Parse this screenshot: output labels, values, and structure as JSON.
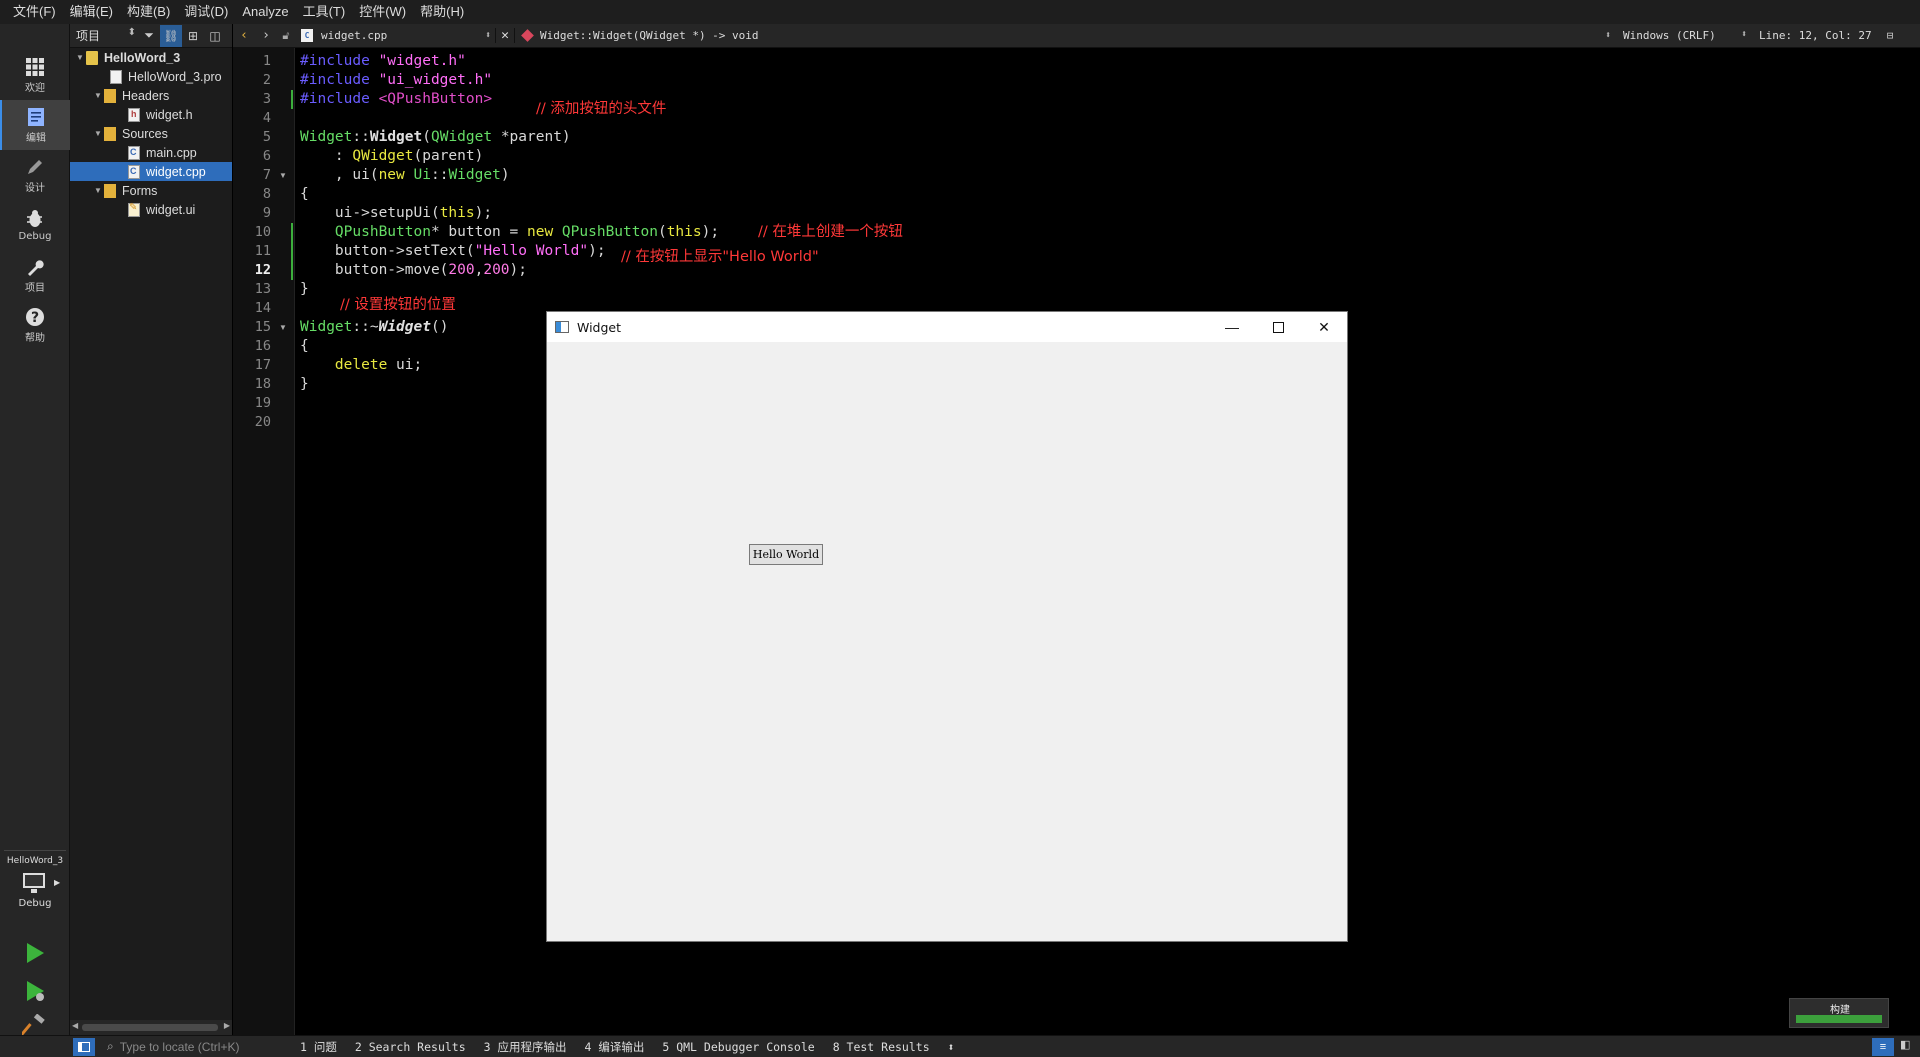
{
  "menubar": [
    "文件(F)",
    "编辑(E)",
    "构建(B)",
    "调试(D)",
    "Analyze",
    "工具(T)",
    "控件(W)",
    "帮助(H)"
  ],
  "modes": [
    {
      "name": "welcome",
      "label": "欢迎"
    },
    {
      "name": "edit",
      "label": "编辑"
    },
    {
      "name": "design",
      "label": "设计"
    },
    {
      "name": "debug",
      "label": "Debug"
    },
    {
      "name": "projects",
      "label": "项目"
    },
    {
      "name": "help",
      "label": "帮助"
    }
  ],
  "kit": {
    "project": "HelloWord_3",
    "mode": "Debug"
  },
  "project_panel": {
    "selector": "项目",
    "tree": [
      {
        "label": "HelloWord_3",
        "type": "proj"
      },
      {
        "label": "HelloWord_3.pro",
        "type": "file"
      },
      {
        "label": "Headers",
        "type": "folder"
      },
      {
        "label": "widget.h",
        "type": "h"
      },
      {
        "label": "Sources",
        "type": "folder"
      },
      {
        "label": "main.cpp",
        "type": "cpp"
      },
      {
        "label": "widget.cpp",
        "type": "cpp"
      },
      {
        "label": "Forms",
        "type": "folder"
      },
      {
        "label": "widget.ui",
        "type": "ui"
      }
    ]
  },
  "editor_toolbar": {
    "document": "widget.cpp",
    "symbol": "Widget::Widget(QWidget *) -> void",
    "line_ending": "Windows (CRLF)",
    "position": "Line: 12, Col: 27"
  },
  "code": {
    "line_numbers": [
      "1",
      "2",
      "3",
      "4",
      "5",
      "6",
      "7",
      "8",
      "9",
      "10",
      "11",
      "12",
      "13",
      "14",
      "15",
      "16",
      "17",
      "18",
      "19",
      "20"
    ],
    "lines": {
      "l1a": "#include",
      "l1b": " \"widget.h\"",
      "l2a": "#include",
      "l2b": " \"ui_widget.h\"",
      "l3a": "#include",
      "l3b": " <QPushButton>",
      "l5a": "Widget",
      "l5b": "::",
      "l5c": "Widget",
      "l5d": "(",
      "l5e": "QWidget",
      "l5f": " *parent)",
      "l6a": "    : ",
      "l6b": "QWidget",
      "l6c": "(parent)",
      "l7a": "    , ui(",
      "l7b": "new",
      "l7c": " ",
      "l7d": "Ui",
      "l7e": "::",
      "l7f": "Widget",
      "l7g": ")",
      "l8": "{",
      "l9a": "    ui->setupUi(",
      "l9b": "this",
      "l9c": ");",
      "l10a": "    ",
      "l10b": "QPushButton",
      "l10c": "* button = ",
      "l10d": "new",
      "l10e": " ",
      "l10f": "QPushButton",
      "l10g": "(",
      "l10h": "this",
      "l10i": ");",
      "l11a": "    button->setText(",
      "l11b": "\"Hello World\"",
      "l11c": ");",
      "l12a": "    button->move(",
      "l12b": "200",
      "l12c": ",",
      "l12d": "200",
      "l12e": ");",
      "l13": "}",
      "l15a": "Widget",
      "l15b": "::~",
      "l15c": "Widget",
      "l15d": "()",
      "l16": "{",
      "l17a": "    ",
      "l17b": "delete",
      "l17c": " ui;",
      "l18": "}"
    },
    "annotations": {
      "a1": "// 添加按钮的头文件",
      "a2": "// 在堆上创建一个按钮",
      "a3": "// 在按钮上显示\"Hello World\"",
      "a4": "// 设置按钮的位置"
    }
  },
  "widget_window": {
    "title": "Widget",
    "button_label": "Hello World"
  },
  "build": {
    "label": "构建",
    "progress": 1.0
  },
  "statusbar": {
    "locator_placeholder": "Type to locate (Ctrl+K)",
    "panes": [
      "1  问题",
      "2  Search Results",
      "3  应用程序输出",
      "4  编译输出",
      "5  QML Debugger Console",
      "8  Test Results"
    ]
  },
  "colors": {
    "accent": "#2e6dbb",
    "annotation": "#ff3838",
    "run_green": "#3cb43c"
  }
}
